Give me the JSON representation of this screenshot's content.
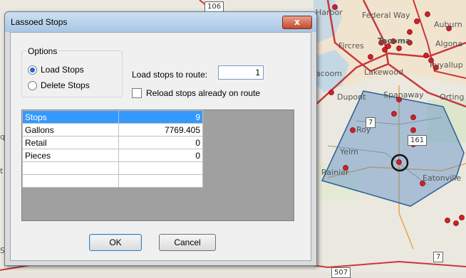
{
  "map": {
    "labels": {
      "harbor": "Harbor",
      "federal_way": "Federal Way",
      "auburn": "Auburn",
      "fircrest": "Fircres",
      "tacoma": "Tacoma",
      "algona": "Algona",
      "puyallup": "Puyallup",
      "acoom": "acoom",
      "lakewood": "Lakewood",
      "dupont": "Dupont",
      "spanaway": "Spanaway",
      "orting": "Orting",
      "roy": "Roy",
      "yelm": "Yelm",
      "rainier": "Rainier",
      "eatonville": "Eatonville",
      "left_qu": "qu",
      "left_t": "t",
      "left_sc": "Sc"
    },
    "shields": {
      "top": "106",
      "hwy7": "7",
      "hwy161": "161",
      "hwy7_bottom": "7",
      "bottom": "507"
    }
  },
  "dialog": {
    "title": "Lassoed Stops",
    "close_label": "x",
    "options": {
      "legend": "Options",
      "load_stops": "Load Stops",
      "delete_stops": "Delete Stops",
      "selected": "load"
    },
    "load_to_route_label": "Load stops to route:",
    "route_value": "1",
    "reload_label": "Reload stops already on route",
    "reload_checked": false,
    "grid": {
      "rows": [
        {
          "name": "Stops",
          "value": "9",
          "selected": true
        },
        {
          "name": "Gallons",
          "value": "7769.405"
        },
        {
          "name": "Retail",
          "value": "0"
        },
        {
          "name": "Pieces",
          "value": "0"
        },
        {
          "name": "",
          "value": ""
        },
        {
          "name": "",
          "value": ""
        }
      ]
    },
    "ok_label": "OK",
    "cancel_label": "Cancel"
  }
}
